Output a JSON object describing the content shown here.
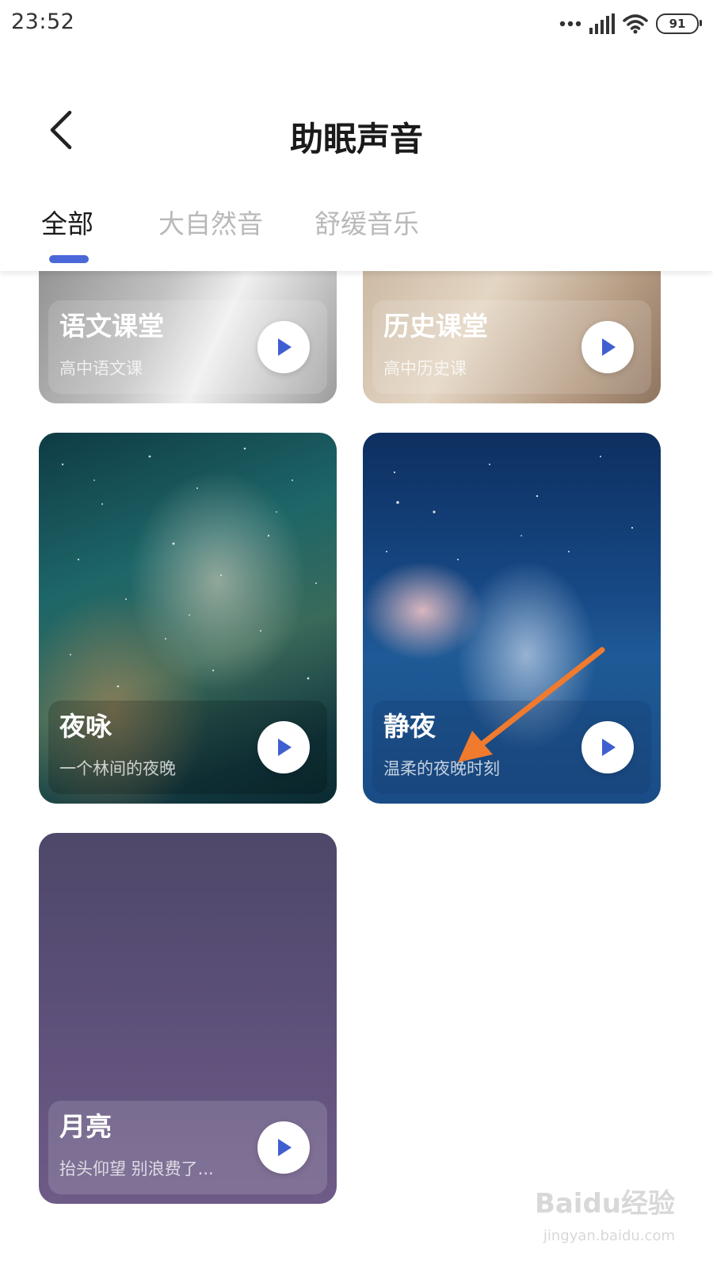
{
  "status_bar": {
    "time": "23:52",
    "battery": "91"
  },
  "header": {
    "title": "助眠声音"
  },
  "tabs": [
    {
      "label": "全部",
      "active": true
    },
    {
      "label": "大自然音",
      "active": false
    },
    {
      "label": "舒缓音乐",
      "active": false
    }
  ],
  "cards": [
    {
      "title": "语文课堂",
      "subtitle": "高中语文课"
    },
    {
      "title": "历史课堂",
      "subtitle": "高中历史课"
    },
    {
      "title": "夜咏",
      "subtitle": "一个林间的夜晚"
    },
    {
      "title": "静夜",
      "subtitle": "温柔的夜晚时刻"
    },
    {
      "title": "月亮",
      "subtitle": "抬头仰望 别浪费了..."
    }
  ],
  "colors": {
    "accent": "#4a68d8",
    "annotation_arrow": "#f07a2e"
  },
  "watermark": {
    "brand": "Baidu经验",
    "url": "jingyan.baidu.com"
  }
}
